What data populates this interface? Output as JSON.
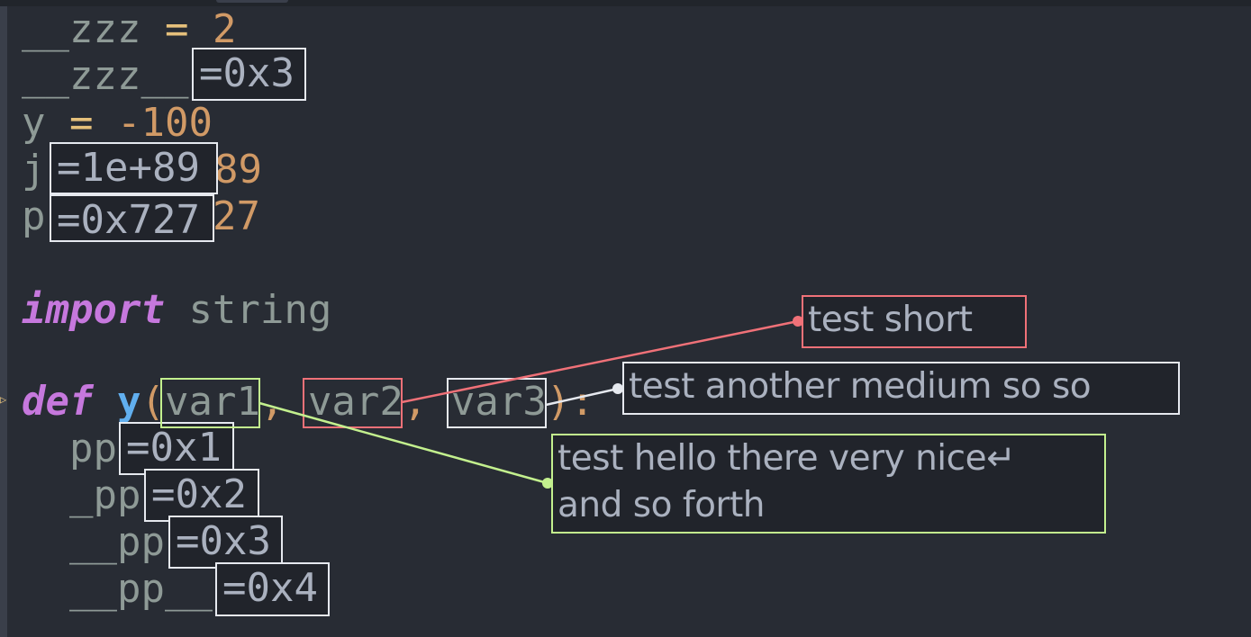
{
  "code": {
    "l1": {
      "name": "__zzz",
      "op": " = ",
      "value": "2"
    },
    "l2": {
      "name": "__zzz__"
    },
    "l3": {
      "name": "y",
      "op": " = ",
      "value": "-100"
    },
    "l4": {
      "name": "j",
      "tail": "89"
    },
    "l5": {
      "name": "p",
      "tail": "27"
    },
    "l7": {
      "keyword": "import",
      "module": " string"
    },
    "l9": {
      "keyword": "def",
      "fname": "y",
      "open": "(",
      "p1": "var1",
      "c1": ", ",
      "p2": "var2",
      "c2": ", ",
      "p3": "var3",
      "close": "):"
    },
    "l10": {
      "name": "pp"
    },
    "l11": {
      "name": "_pp"
    },
    "l12": {
      "name": "__pp"
    },
    "l13": {
      "name": "__pp__"
    }
  },
  "inline_values": {
    "zzz_dunder": "=0x3",
    "j": "=1e+89",
    "p": "=0x727",
    "pp": "=0x1",
    "_pp": "=0x2",
    "__pp": "=0x3",
    "__pp__": "=0x4"
  },
  "annotations": [
    {
      "param": "var2",
      "text": "test short",
      "color": "#f07178"
    },
    {
      "param": "var3",
      "text": "test another medium so so",
      "color": "#e6e9ef"
    },
    {
      "param": "var1",
      "text": "test hello there very nice↵\nand so forth",
      "color": "#c3f08e"
    }
  ],
  "colors": {
    "background": "#282c34",
    "keyword": "#c678dd",
    "function": "#61afef",
    "number": "#d19a66",
    "operator": "#e5c07b"
  }
}
